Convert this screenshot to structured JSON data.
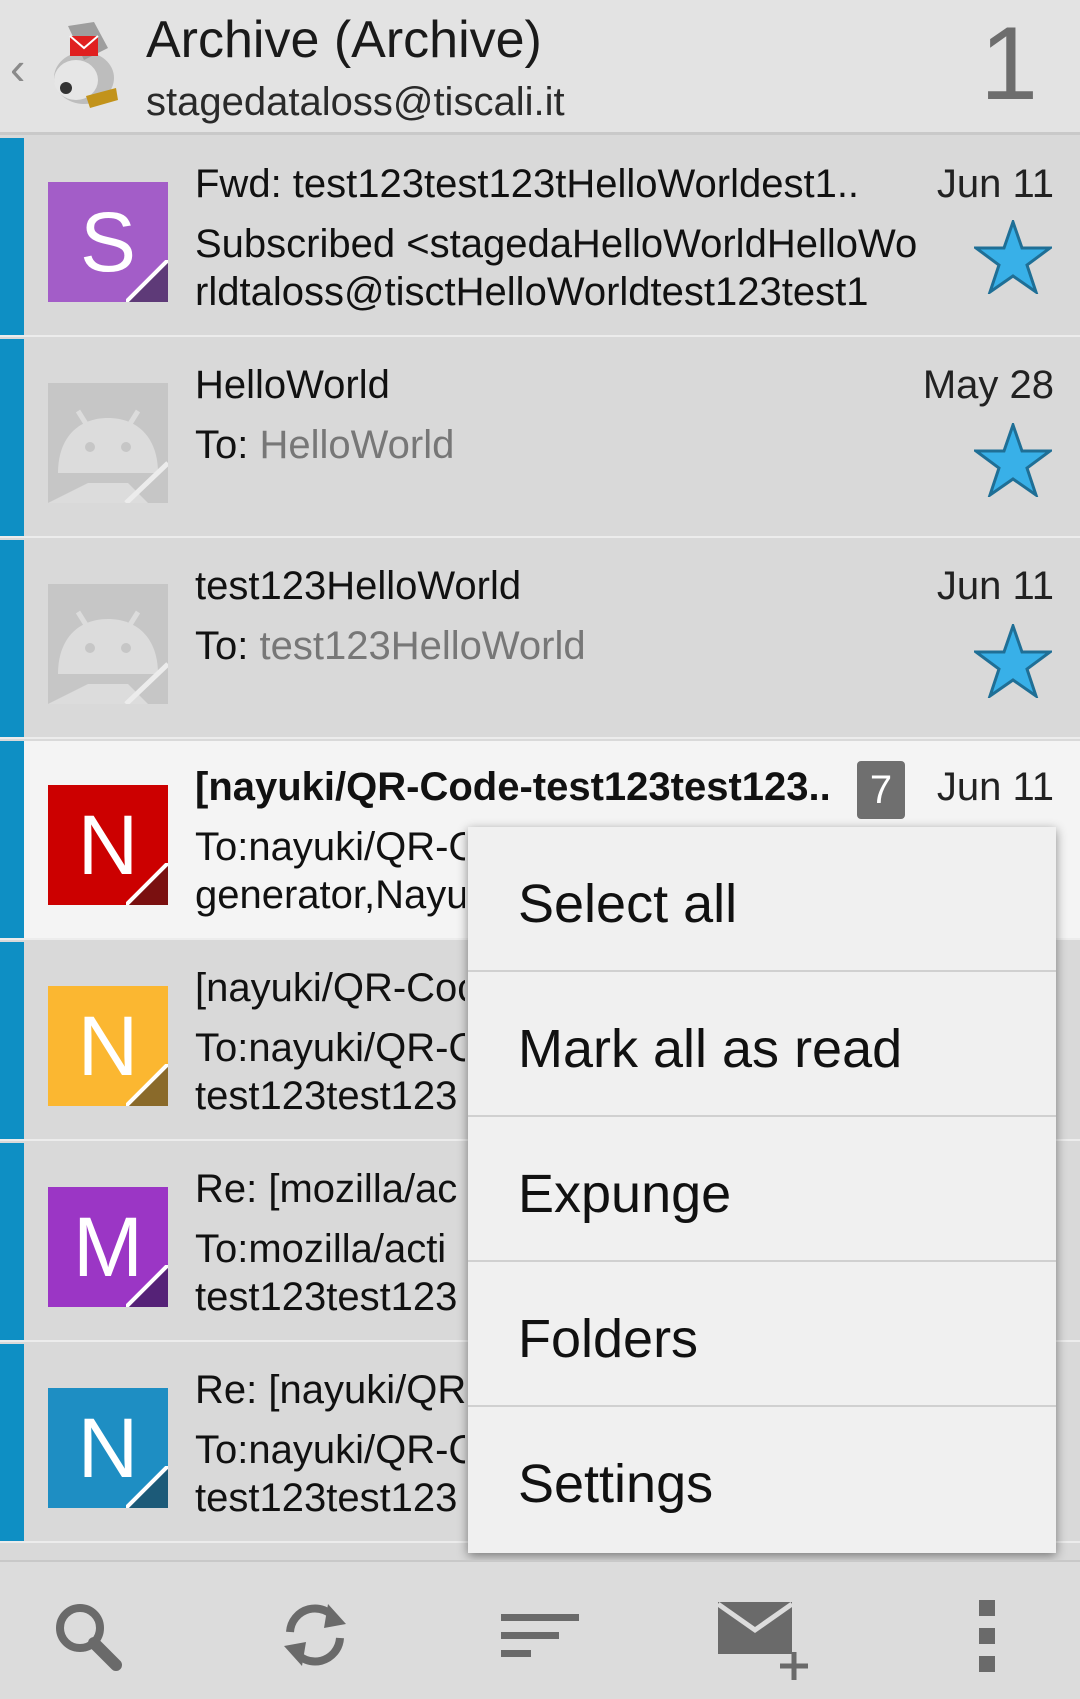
{
  "header": {
    "title": "Archive (Archive)",
    "account": "stagedataloss@tiscali.it",
    "unread_count": "1",
    "back_icon": "chevron-left-icon",
    "logo_icon": "k9-mail-dog-logo"
  },
  "messages": [
    {
      "subject": "Fwd: test123test123tHelloWorldest1..",
      "date": "Jun 11",
      "line2": "Subscribed <stagedaHelloWorldHelloWo",
      "line3": "rldtaloss@tisctHelloWorldtest123test1",
      "avatar_letter": "S",
      "avatar_color": "#a35dc8",
      "starred": true,
      "unread": false
    },
    {
      "subject": "HelloWorld",
      "date": "May 28",
      "to_label": "To: ",
      "to_value": "HelloWorld",
      "avatar_letter": "",
      "avatar_color": "#c6c6c6",
      "starred": true,
      "unread": false
    },
    {
      "subject": "test123HelloWorld",
      "date": "Jun 11",
      "to_label": "To: ",
      "to_value": "test123HelloWorld",
      "avatar_letter": "",
      "avatar_color": "#c6c6c6",
      "starred": true,
      "unread": false
    },
    {
      "subject": "[nayuki/QR-Code-test123test123..",
      "date": "Jun 11",
      "thread_count": "7",
      "line2": "To:nayuki/QR-C",
      "line3": "generator,Nayu",
      "avatar_letter": "N",
      "avatar_color": "#cc0000",
      "starred": false,
      "unread": true
    },
    {
      "subject": "[nayuki/QR-Coc",
      "line2": "To:nayuki/QR-C",
      "line3": "test123test123",
      "avatar_letter": "N",
      "avatar_color": "#fbb731",
      "unread": false
    },
    {
      "subject": "Re: [mozilla/ac",
      "line2": "To:mozilla/acti",
      "line3": "test123test123",
      "avatar_letter": "M",
      "avatar_color": "#9b36c5",
      "unread": false
    },
    {
      "subject": "Re: [nayuki/QR-",
      "line2": "To:nayuki/QR-C",
      "line3": "test123test123",
      "avatar_letter": "N",
      "avatar_color": "#1e8ec3",
      "unread": false
    }
  ],
  "menu": {
    "items": [
      "Select all",
      "Mark all as read",
      "Expunge",
      "Folders",
      "Settings"
    ]
  },
  "bottom_bar": {
    "icons": [
      "search-icon",
      "refresh-icon",
      "sort-icon",
      "compose-icon",
      "overflow-menu-icon"
    ]
  },
  "colors": {
    "accent_stripe": "#0e8fc4",
    "star": "#38b0e8",
    "list_bg": "#d9d9d9",
    "unread_row_bg": "#f4f4f4"
  }
}
